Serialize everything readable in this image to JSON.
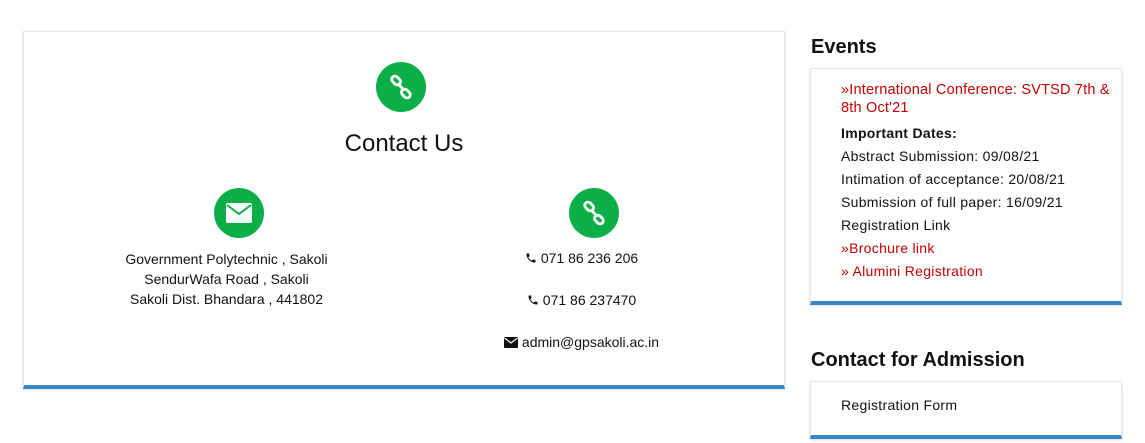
{
  "contact": {
    "title": "Contact Us",
    "address_line1": "Government Polytechnic , Sakoli",
    "address_line2": "SendurWafa Road , Sakoli",
    "address_line3": "Sakoli Dist. Bhandara , 441802",
    "phone1": "071 86 236 206",
    "phone2": "071 86 237470",
    "email": "admin@gpsakoli.ac.in",
    "icons": {
      "top": "link-icon",
      "address": "envelope-icon",
      "right": "link-icon",
      "phone": "phone-icon",
      "email": "envelope-icon"
    }
  },
  "events": {
    "heading": "Events",
    "conference_link": "»International Conference: SVTSD 7th & 8th Oct'21",
    "important_dates": "Important Dates:",
    "abstract": "Abstract Submission: 09/08/21",
    "intimation": "Intimation of acceptance: 20/08/21",
    "full_paper": "Submission of full paper: 16/09/21",
    "registration": "Registration Link",
    "brochure": "»Brochure link",
    "alumni": "» Alumini Registration"
  },
  "admission": {
    "heading": "Contact for Admission",
    "registration_form": "Registration Form"
  },
  "colors": {
    "icon_circle": "#0cae47",
    "accent_border": "#3a87c8",
    "link_red": "#c40000"
  }
}
